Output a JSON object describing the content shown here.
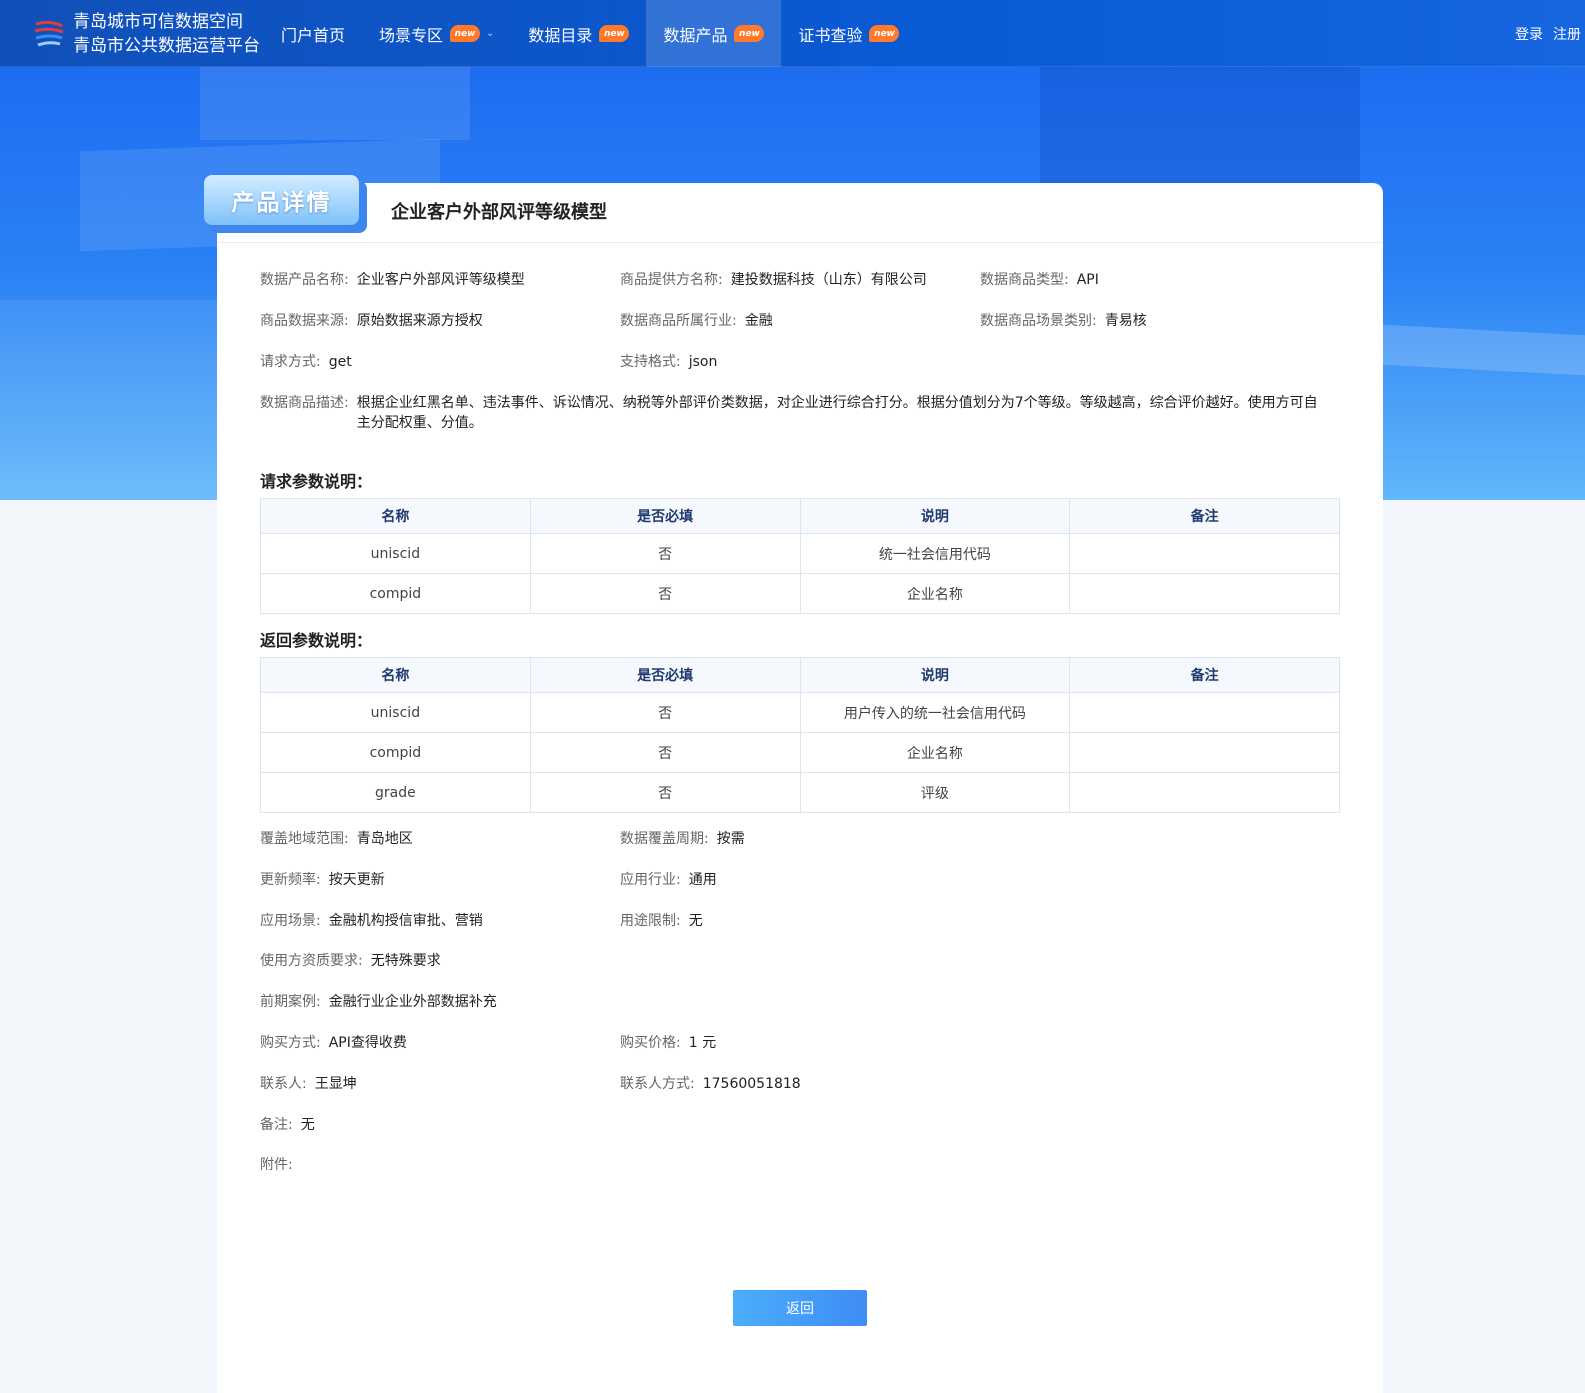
{
  "header": {
    "brand_line1": "青岛城市可信数据空间",
    "brand_line2": "青岛市公共数据运营平台",
    "nav": [
      {
        "label": "门户首页",
        "badge": ""
      },
      {
        "label": "场景专区",
        "badge": "new"
      },
      {
        "label": "数据目录",
        "badge": "new"
      },
      {
        "label": "数据产品",
        "badge": "new"
      },
      {
        "label": "证书查验",
        "badge": "new"
      }
    ],
    "login": "登录",
    "register": "注册"
  },
  "card": {
    "tag": "产品详情",
    "title": "企业客户外部风评等级模型"
  },
  "info": {
    "product_name": {
      "label": "数据产品名称:",
      "value": "企业客户外部风评等级模型"
    },
    "provider": {
      "label": "商品提供方名称:",
      "value": "建投数据科技（山东）有限公司"
    },
    "type": {
      "label": "数据商品类型:",
      "value": "API"
    },
    "source": {
      "label": "商品数据来源:",
      "value": "原始数据来源方授权"
    },
    "industry": {
      "label": "数据商品所属行业:",
      "value": "金融"
    },
    "scene": {
      "label": "数据商品场景类别:",
      "value": "青易核"
    },
    "method": {
      "label": "请求方式:",
      "value": "get"
    },
    "format": {
      "label": "支持格式:",
      "value": "json"
    },
    "description": {
      "label": "数据商品描述:",
      "value": "根据企业红黑名单、违法事件、诉讼情况、纳税等外部评价类数据，对企业进行综合打分。根据分值划分为7个等级。等级越高，综合评价越好。使用方可自主分配权重、分值。"
    }
  },
  "request_params": {
    "title": "请求参数说明：",
    "headers": [
      "名称",
      "是否必填",
      "说明",
      "备注"
    ],
    "rows": [
      [
        "uniscid",
        "否",
        "统一社会信用代码",
        ""
      ],
      [
        "compid",
        "否",
        "企业名称",
        ""
      ]
    ]
  },
  "response_params": {
    "title": "返回参数说明：",
    "headers": [
      "名称",
      "是否必填",
      "说明",
      "备注"
    ],
    "rows": [
      [
        "uniscid",
        "否",
        "用户传入的统一社会信用代码",
        ""
      ],
      [
        "compid",
        "否",
        "企业名称",
        ""
      ],
      [
        "grade",
        "否",
        "评级",
        ""
      ]
    ]
  },
  "details": {
    "coverage_area": {
      "label": "覆盖地域范围:",
      "value": "青岛地区"
    },
    "coverage_period": {
      "label": "数据覆盖周期:",
      "value": "按需"
    },
    "update_freq": {
      "label": "更新频率:",
      "value": "按天更新"
    },
    "app_industry": {
      "label": "应用行业:",
      "value": "通用"
    },
    "app_scene": {
      "label": "应用场景:",
      "value": "金融机构授信审批、营销"
    },
    "usage_limit": {
      "label": "用途限制:",
      "value": "无"
    },
    "qualification": {
      "label": "使用方资质要求:",
      "value": "无特殊要求"
    },
    "cases": {
      "label": "前期案例:",
      "value": "金融行业企业外部数据补充"
    },
    "purchase_method": {
      "label": "购买方式:",
      "value": "API查得收费"
    },
    "price": {
      "label": "购买价格:",
      "value": "1 元"
    },
    "contact": {
      "label": "联系人:",
      "value": "王显坤"
    },
    "contact_phone": {
      "label": "联系人方式:",
      "value": "17560051818"
    },
    "remark": {
      "label": "备注:",
      "value": "无"
    },
    "attachment": {
      "label": "附件:",
      "value": ""
    }
  },
  "back_button": "返回",
  "colors": {
    "primary": "#1a66f0",
    "badge": "#ff7a2a",
    "table_header_text": "#1e3a6e"
  }
}
